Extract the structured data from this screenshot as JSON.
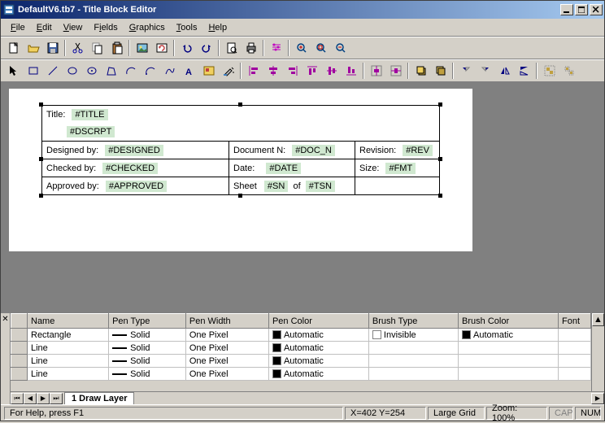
{
  "window": {
    "title": "DefaultV6.tb7 - Title Block Editor"
  },
  "menu": {
    "file": "File",
    "edit": "Edit",
    "view": "View",
    "fields": "Fields",
    "graphics": "Graphics",
    "tools": "Tools",
    "help": "Help"
  },
  "titleblock": {
    "title_label": "Title:",
    "title_field": "#TITLE",
    "descr_field": "#DSCRPT",
    "designed_label": "Designed by:",
    "designed_field": "#DESIGNED",
    "document_label": "Document N:",
    "document_field": "#DOC_N",
    "revision_label": "Revision:",
    "revision_field": "#REV",
    "checked_label": "Checked by:",
    "checked_field": "#CHECKED",
    "date_label": "Date:",
    "date_field": "#DATE",
    "size_label": "Size:",
    "size_field": "#FMT",
    "approved_label": "Approved by:",
    "approved_field": "#APPROVED",
    "sheet_label": "Sheet",
    "sheet_n": "#SN",
    "sheet_of": "of",
    "sheet_total": "#TSN"
  },
  "grid": {
    "headers": {
      "name": "Name",
      "pentype": "Pen Type",
      "penwidth": "Pen Width",
      "pencolor": "Pen Color",
      "brushtype": "Brush Type",
      "brushcolor": "Brush Color",
      "font": "Font"
    },
    "rows": [
      {
        "name": "Rectangle",
        "pentype": "Solid",
        "penwidth": "One Pixel",
        "pencolor": "Automatic",
        "brushtype": "Invisible",
        "brushcolor": "Automatic",
        "pencolor_hex": "#000",
        "brushtype_hex": "#fff",
        "brushcolor_hex": "#000"
      },
      {
        "name": "Line",
        "pentype": "Solid",
        "penwidth": "One Pixel",
        "pencolor": "Automatic",
        "brushtype": "",
        "brushcolor": "",
        "pencolor_hex": "#000"
      },
      {
        "name": "Line",
        "pentype": "Solid",
        "penwidth": "One Pixel",
        "pencolor": "Automatic",
        "brushtype": "",
        "brushcolor": "",
        "pencolor_hex": "#000"
      },
      {
        "name": "Line",
        "pentype": "Solid",
        "penwidth": "One Pixel",
        "pencolor": "Automatic",
        "brushtype": "",
        "brushcolor": "",
        "pencolor_hex": "#000"
      }
    ],
    "tab": "1 Draw Layer"
  },
  "status": {
    "help": "For Help, press F1",
    "coords": "X=402 Y=254",
    "grid": "Large Grid",
    "zoom": "Zoom: 100%",
    "cap": "CAP",
    "num": "NUM"
  }
}
